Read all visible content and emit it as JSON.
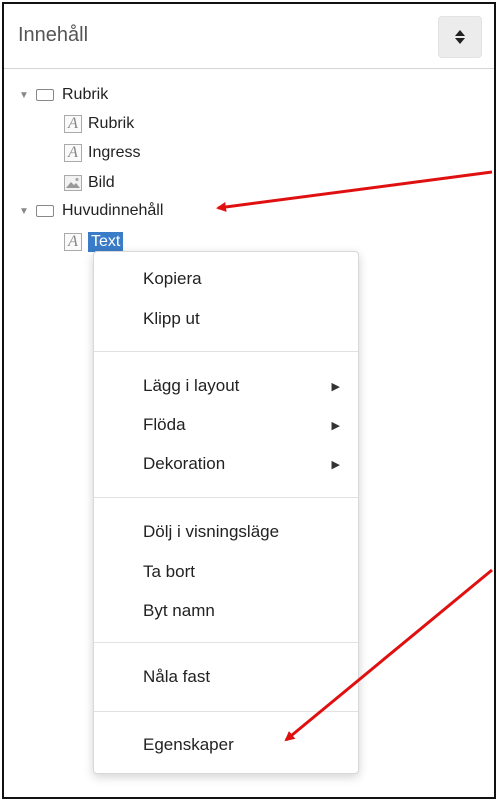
{
  "panel": {
    "title": "Innehåll"
  },
  "tree": {
    "rubrik_group": "Rubrik",
    "rubrik_item": "Rubrik",
    "ingress_item": "Ingress",
    "bild_item": "Bild",
    "huvud_group": "Huvudinnehåll",
    "text_item": "Text"
  },
  "menu": {
    "kopiera": "Kopiera",
    "klipp_ut": "Klipp ut",
    "lagg_i_layout": "Lägg i layout",
    "floda": "Flöda",
    "dekoration": "Dekoration",
    "dolj": "Dölj i visningsläge",
    "ta_bort": "Ta bort",
    "byt_namn": "Byt namn",
    "nala_fast": "Nåla fast",
    "egenskaper": "Egenskaper",
    "submenu_arrow": "▶"
  },
  "icons": {
    "expanded_caret": "▼",
    "text_icon_glyph": "A",
    "sort_icon": "sort-icon"
  },
  "colors": {
    "selection": "#3a7cc8",
    "annotation_arrow": "#e01010"
  }
}
